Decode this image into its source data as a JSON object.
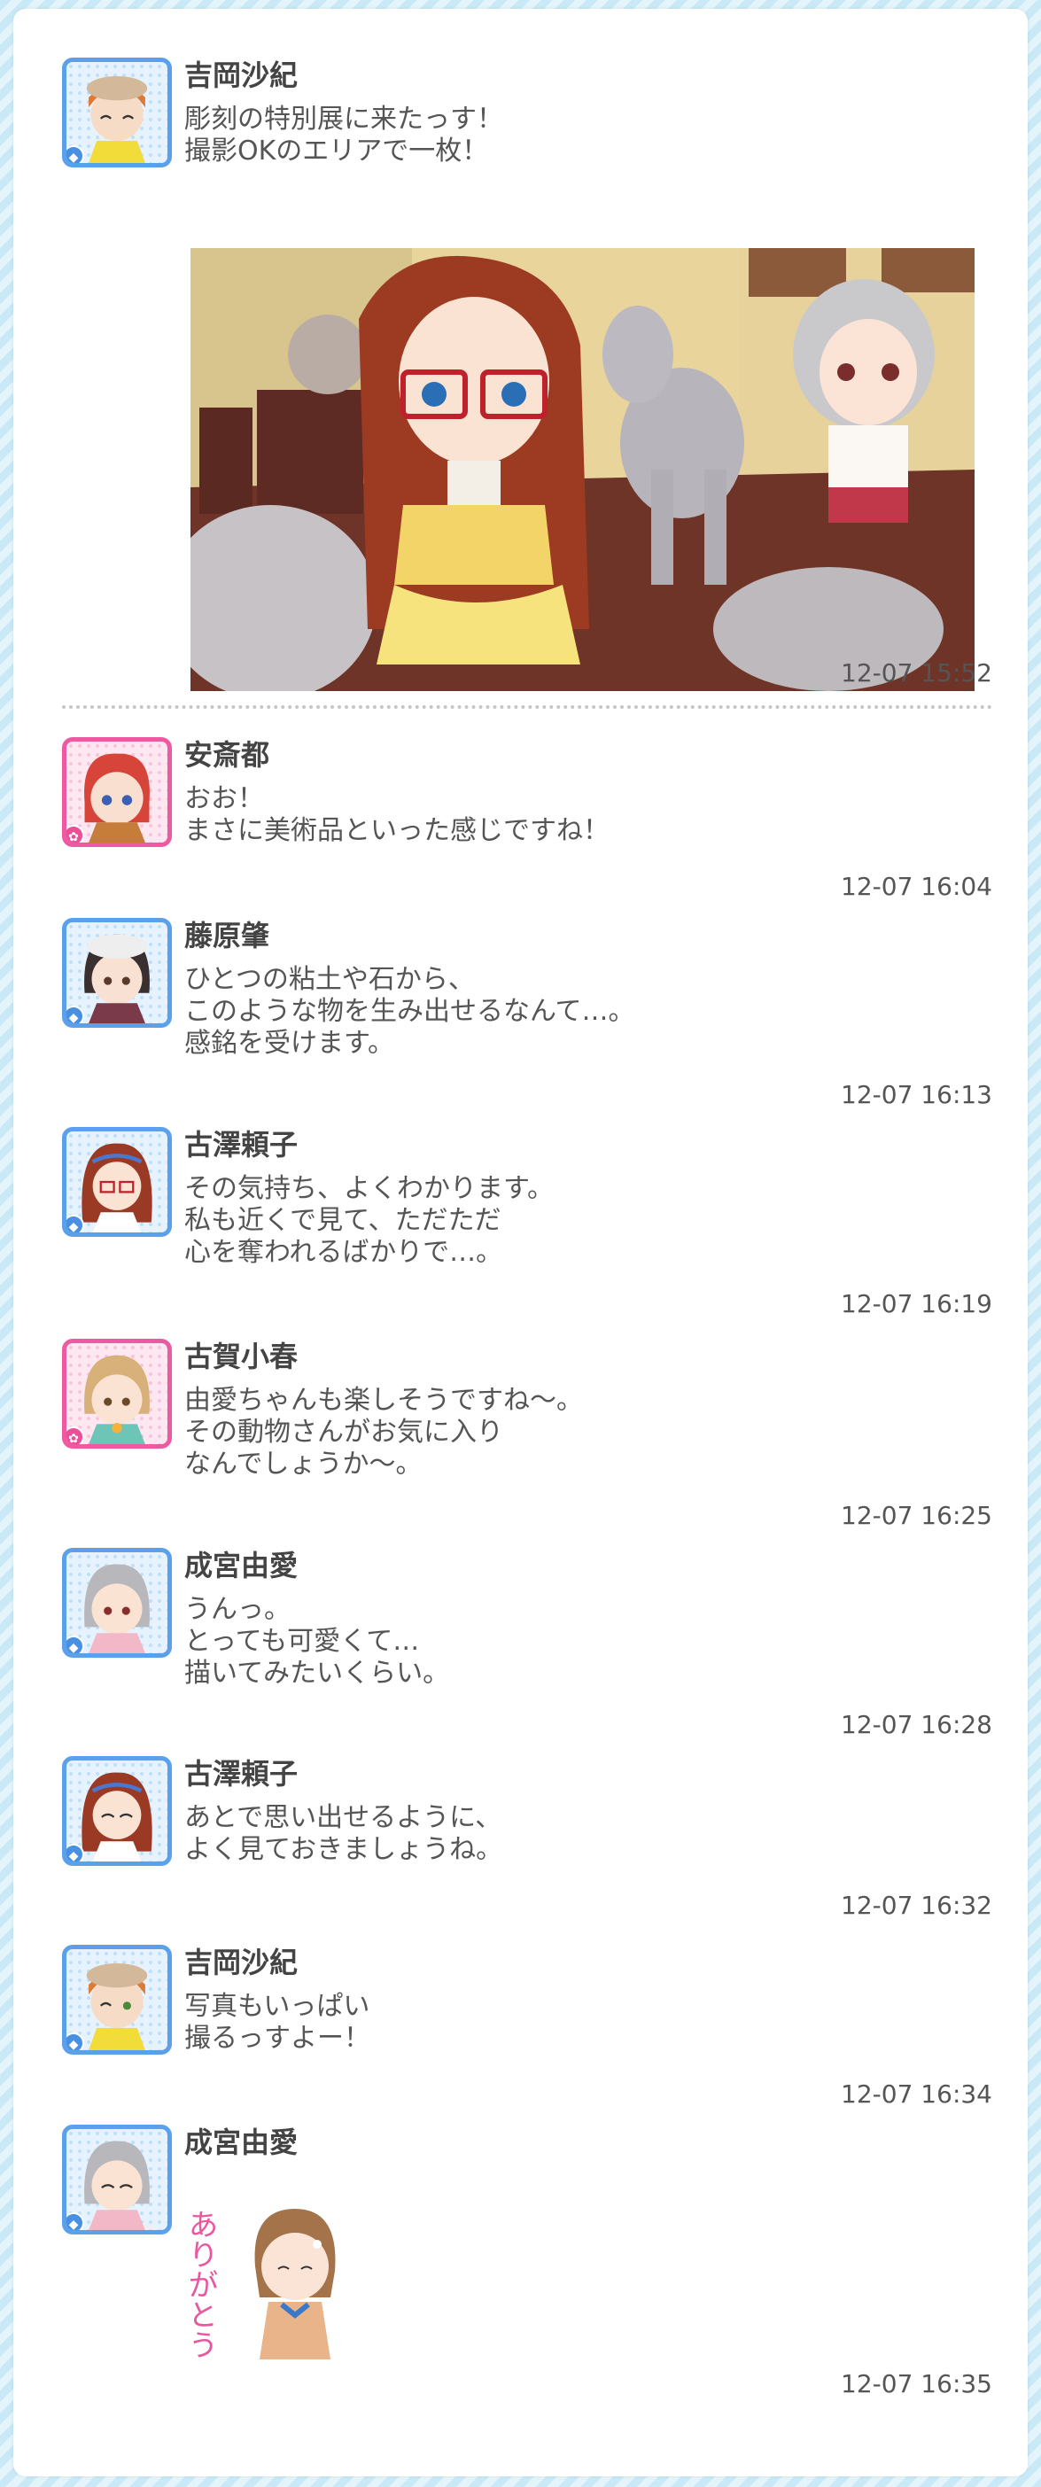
{
  "messages": [
    {
      "name": "吉岡沙紀",
      "text": "彫刻の特別展に来たっす！\n撮影OKのエリアで一枚！",
      "time": "12-07 15:52",
      "attachment": "photo",
      "attribute": "cool"
    },
    {
      "name": "安斎都",
      "text": "おお！\nまさに美術品といった感じですね！",
      "time": "12-07 16:04",
      "attribute": "cute"
    },
    {
      "name": "藤原肇",
      "text": "ひとつの粘土や石から、\nこのような物を生み出せるなんて…。\n感銘を受けます。",
      "time": "12-07 16:13",
      "attribute": "cool"
    },
    {
      "name": "古澤頼子",
      "text": "その気持ち、よくわかります。\n私も近くで見て、ただただ\n心を奪われるばかりで…。",
      "time": "12-07 16:19",
      "attribute": "cool"
    },
    {
      "name": "古賀小春",
      "text": "由愛ちゃんも楽しそうですね～。\nその動物さんがお気に入り\nなんでしょうか～。",
      "time": "12-07 16:25",
      "attribute": "cute"
    },
    {
      "name": "成宮由愛",
      "text": "うんっ。\nとっても可愛くて…\n描いてみたいくらい。",
      "time": "12-07 16:28",
      "attribute": "cool"
    },
    {
      "name": "古澤頼子",
      "text": "あとで思い出せるように、\nよく見ておきましょうね。",
      "time": "12-07 16:32",
      "attribute": "cool"
    },
    {
      "name": "吉岡沙紀",
      "text": "写真もいっぱい\n撮るっすよー！",
      "time": "12-07 16:34",
      "attribute": "cool"
    },
    {
      "name": "成宮由愛",
      "text": "",
      "time": "12-07 16:35",
      "attachment": "sticker",
      "sticker_text": "ありがとう",
      "attribute": "cool"
    }
  ],
  "colors": {
    "cool_frame": "#5aa0ea",
    "cute_frame": "#ee5aa2",
    "background_stripe": "#c9e9f7",
    "card": "#ffffff",
    "divider": "#c6c6c6"
  },
  "icons": {
    "cool_badge": "diamond-icon",
    "cute_badge": "flower-icon"
  }
}
